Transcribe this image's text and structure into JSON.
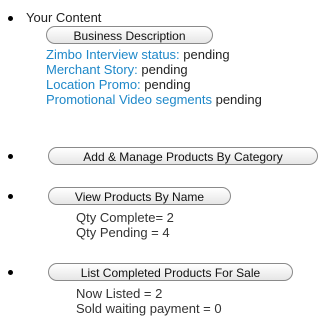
{
  "sections": {
    "your_content": {
      "heading": "Your Content",
      "button_label": "Business Description",
      "statuses": [
        {
          "label": "Zimbo Interview status:",
          "value": "pending"
        },
        {
          "label": "Merchant Story:",
          "value": "pending"
        },
        {
          "label": "Location Promo:",
          "value": "pending"
        },
        {
          "label": "Promotional Video segments",
          "value": "pending"
        }
      ]
    },
    "add_manage": {
      "button_label": "Add & Manage Products By Category"
    },
    "view_by_name": {
      "button_label": "View Products By Name",
      "lines": [
        "Qty Complete= 2",
        "Qty Pending = 4"
      ]
    },
    "list_completed": {
      "button_label": "List Completed Products For Sale",
      "lines": [
        "Now Listed = 2",
        "Sold waiting payment = 0"
      ]
    }
  }
}
